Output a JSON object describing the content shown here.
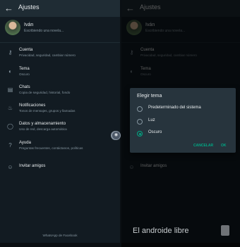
{
  "header": {
    "back_icon": "arrow-left-icon",
    "title": "Ajustes"
  },
  "profile": {
    "name": "Iván",
    "status": "Escribiendo una novela..."
  },
  "settings_items": [
    {
      "icon": "key-icon",
      "title": "Cuenta",
      "subtitle": "Privacidad, seguridad, cambiar número"
    },
    {
      "icon": "theme-icon",
      "title": "Tema",
      "subtitle": "Oscuro"
    },
    {
      "icon": "chat-icon",
      "title": "Chats",
      "subtitle": "Copia de seguridad, historial, fondo"
    },
    {
      "icon": "bell-icon",
      "title": "Notificaciones",
      "subtitle": "Tonos de mensajes, grupos y llamadas"
    },
    {
      "icon": "data-usage-icon",
      "title": "Datos y almacenamiento",
      "subtitle": "Uso de red, descarga automática"
    },
    {
      "icon": "help-icon",
      "title": "Ayuda",
      "subtitle": "Preguntas frecuentes, contáctanos, políticas"
    },
    {
      "icon": "people-icon",
      "title": "Invitar amigos",
      "subtitle": ""
    }
  ],
  "footer": "WhatsApp de Facebook",
  "dialog": {
    "title": "Elegir tema",
    "options": [
      "Predeterminado del sistema",
      "Luz",
      "Oscuro"
    ],
    "selected": "Oscuro",
    "cancel": "CANCELAR",
    "ok": "OK"
  },
  "watermark": "El androide libre",
  "colors": {
    "accent": "#00a884",
    "background": "#121b22",
    "appbar": "#1f2c34",
    "text": "#e9edef",
    "secondary_text": "#8696a0"
  }
}
